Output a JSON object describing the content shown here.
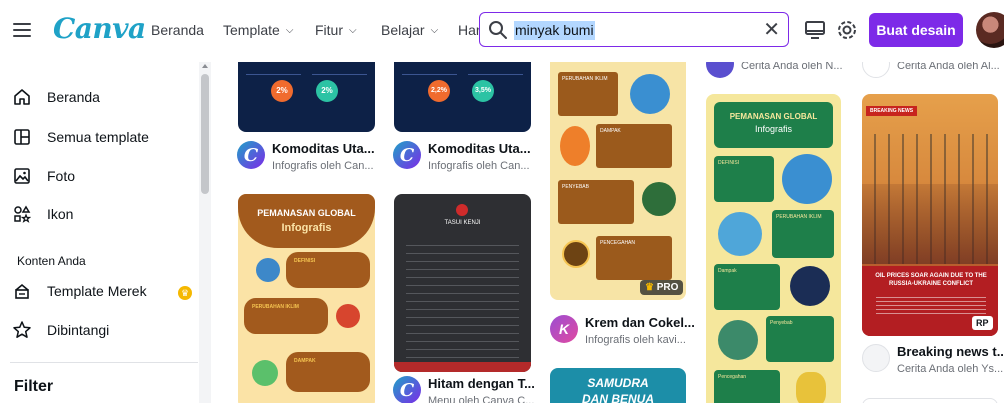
{
  "header": {
    "logo": "Canva",
    "nav": [
      {
        "label": "Beranda",
        "has_chevron": false
      },
      {
        "label": "Template",
        "has_chevron": true
      },
      {
        "label": "Fitur",
        "has_chevron": true
      },
      {
        "label": "Belajar",
        "has_chevron": true
      },
      {
        "label": "Har",
        "has_chevron": false
      }
    ],
    "search_value": "minyak bumi",
    "create_button": "Buat desain",
    "chevron": "⌵"
  },
  "sidebar": {
    "items": [
      {
        "label": "Beranda",
        "icon": "home-icon"
      },
      {
        "label": "Semua template",
        "icon": "template-grid-icon"
      },
      {
        "label": "Foto",
        "icon": "photo-icon"
      },
      {
        "label": "Ikon",
        "icon": "shapes-icon"
      }
    ],
    "section_heading": "Konten Anda",
    "section_items": [
      {
        "label": "Template Merek",
        "icon": "brand-template-icon"
      },
      {
        "label": "Dibintangi",
        "icon": "star-icon"
      }
    ],
    "filter_label": "Filter"
  },
  "results": {
    "col1_top": {
      "title": "Komoditas Uta...",
      "subtitle": "Infografis oleh Can...",
      "stats": [
        "2%",
        "2%"
      ]
    },
    "col2_top": {
      "title": "Komoditas Uta...",
      "subtitle": "Infografis oleh Can...",
      "stats": [
        "2,2%",
        "3,5%"
      ]
    },
    "col1_card2": {
      "heading_line1": "PEMANASAN GLOBAL",
      "heading_line2": "Infografis",
      "sections": [
        "DEFINISI",
        "PERUBAHAN IKLIM",
        "DAMPAK"
      ]
    },
    "col2_card2": {
      "heading": "TASUI KENJI",
      "title": "Hitam dengan T...",
      "subtitle": "Menu oleh Canva C..."
    },
    "col3_card1": {
      "sections": [
        "PERUBAHAN IKLIM",
        "DAMPAK",
        "PENYEBAB",
        "PENCEGAHAN"
      ],
      "pro_label": "PRO",
      "title": "Krem dan Cokel...",
      "subtitle": "Infografis oleh kavi..."
    },
    "col3_card2": {
      "heading_line1": "SAMUDRA",
      "heading_line2": "DAN BENUA"
    },
    "col4_top": {
      "subtitle": "Cerita Anda oleh N..."
    },
    "col4_card": {
      "heading_line1": "PEMANASAN GLOBAL",
      "heading_line2": "Infografis",
      "sections": [
        "DEFINISI",
        "PERUBAHAN IKLIM",
        "Dampak",
        "Penyebab",
        "Pencegahan"
      ]
    },
    "col5_top": {
      "subtitle": "Cerita Anda oleh Al..."
    },
    "col5_card": {
      "badge": "BREAKING NEWS",
      "headline": "OIL PRICES SOAR AGAIN DUE TO THE RUSSIA-UKRAINE CONFLICT",
      "rp_label": "RP",
      "title": "Breaking news t...",
      "subtitle": "Cerita Anda oleh Ys..."
    }
  }
}
